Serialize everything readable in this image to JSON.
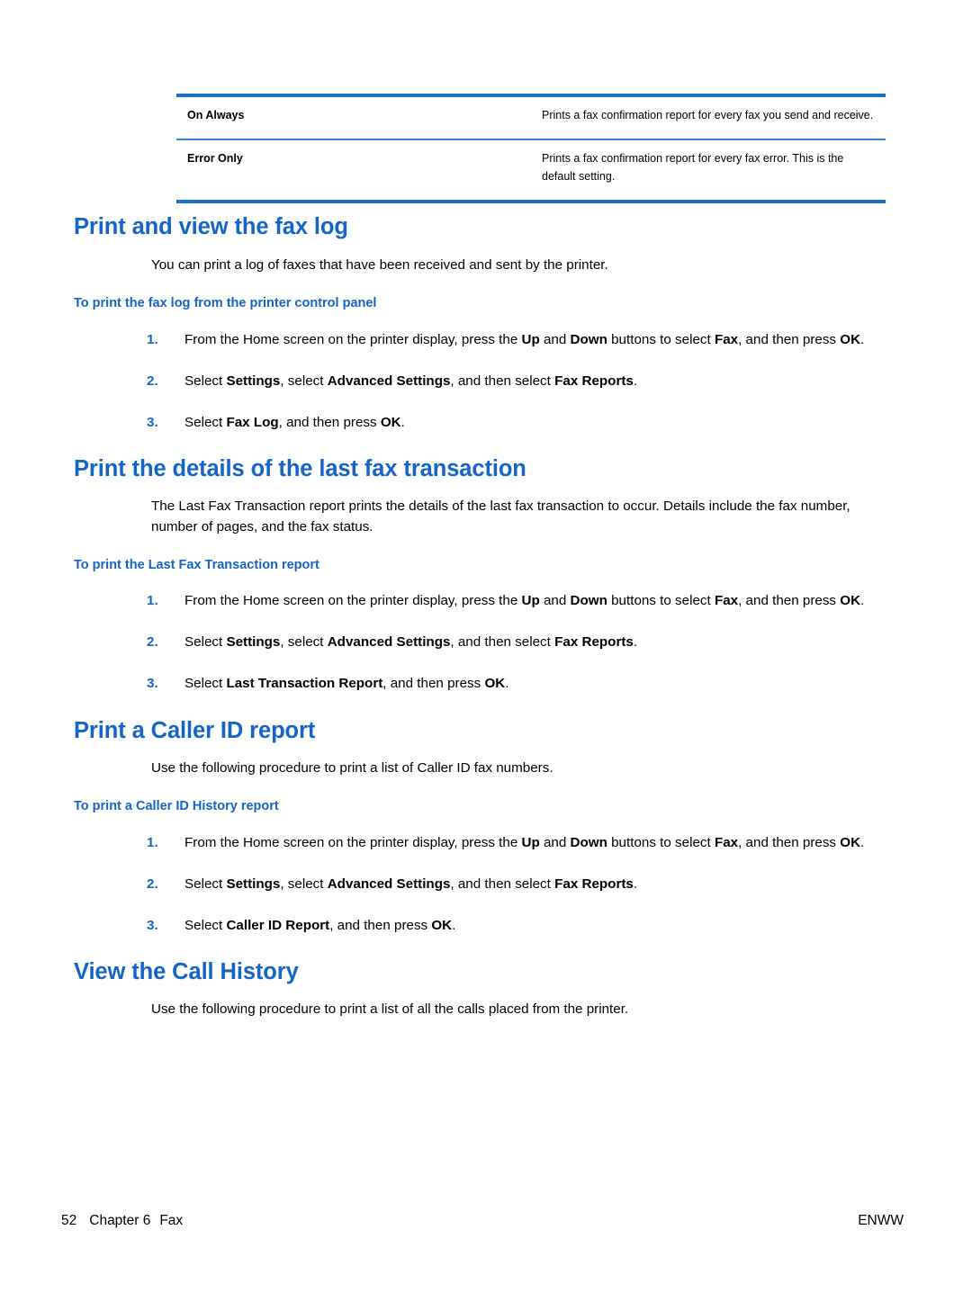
{
  "colors": {
    "heading_blue": "#1565c8",
    "rule_blue": "#1a72c4",
    "divider_blue": "#2f86d4",
    "text_black": "#000000"
  },
  "table": {
    "rows": [
      {
        "name": "On Always",
        "description": "Prints a fax confirmation report for every fax you send and receive."
      },
      {
        "name": "Error Only",
        "description": "Prints a fax confirmation report for every fax error. This is the default setting."
      }
    ]
  },
  "sections": [
    {
      "heading": "Print and view the fax log",
      "intro": "You can print a log of faxes that have been received and sent by the printer.",
      "subheading": "To print the fax log from the printer control panel",
      "steps": [
        {
          "num": "1.",
          "parts": [
            {
              "t": "From the Home screen on the printer display, press the ",
              "b": false
            },
            {
              "t": "Up",
              "b": true
            },
            {
              "t": " and ",
              "b": false
            },
            {
              "t": "Down",
              "b": true
            },
            {
              "t": " buttons to select ",
              "b": false
            },
            {
              "t": "Fax",
              "b": true
            },
            {
              "t": ", and then press ",
              "b": false
            },
            {
              "t": "OK",
              "b": true
            },
            {
              "t": ".",
              "b": false
            }
          ]
        },
        {
          "num": "2.",
          "parts": [
            {
              "t": "Select ",
              "b": false
            },
            {
              "t": "Settings",
              "b": true
            },
            {
              "t": ", select ",
              "b": false
            },
            {
              "t": "Advanced Settings",
              "b": true
            },
            {
              "t": ", and then select ",
              "b": false
            },
            {
              "t": "Fax Reports",
              "b": true
            },
            {
              "t": ".",
              "b": false
            }
          ]
        },
        {
          "num": "3.",
          "parts": [
            {
              "t": "Select ",
              "b": false
            },
            {
              "t": "Fax Log",
              "b": true
            },
            {
              "t": ", and then press ",
              "b": false
            },
            {
              "t": "OK",
              "b": true
            },
            {
              "t": ".",
              "b": false
            }
          ]
        }
      ]
    },
    {
      "heading": "Print the details of the last fax transaction",
      "intro": "The Last Fax Transaction report prints the details of the last fax transaction to occur. Details include the fax number, number of pages, and the fax status.",
      "subheading": "To print the Last Fax Transaction report",
      "steps": [
        {
          "num": "1.",
          "parts": [
            {
              "t": "From the Home screen on the printer display, press the ",
              "b": false
            },
            {
              "t": "Up",
              "b": true
            },
            {
              "t": " and ",
              "b": false
            },
            {
              "t": "Down",
              "b": true
            },
            {
              "t": " buttons to select ",
              "b": false
            },
            {
              "t": "Fax",
              "b": true
            },
            {
              "t": ", and then press ",
              "b": false
            },
            {
              "t": "OK",
              "b": true
            },
            {
              "t": ".",
              "b": false
            }
          ]
        },
        {
          "num": "2.",
          "parts": [
            {
              "t": "Select ",
              "b": false
            },
            {
              "t": "Settings",
              "b": true
            },
            {
              "t": ", select ",
              "b": false
            },
            {
              "t": "Advanced Settings",
              "b": true
            },
            {
              "t": ", and then select ",
              "b": false
            },
            {
              "t": "Fax Reports",
              "b": true
            },
            {
              "t": ".",
              "b": false
            }
          ]
        },
        {
          "num": "3.",
          "parts": [
            {
              "t": "Select ",
              "b": false
            },
            {
              "t": "Last Transaction Report",
              "b": true
            },
            {
              "t": ", and then press ",
              "b": false
            },
            {
              "t": "OK",
              "b": true
            },
            {
              "t": ".",
              "b": false
            }
          ]
        }
      ]
    },
    {
      "heading": "Print a Caller ID report",
      "intro": "Use the following procedure to print a list of Caller ID fax numbers.",
      "subheading": "To print a Caller ID History report",
      "steps": [
        {
          "num": "1.",
          "parts": [
            {
              "t": "From the Home screen on the printer display, press the ",
              "b": false
            },
            {
              "t": "Up",
              "b": true
            },
            {
              "t": " and ",
              "b": false
            },
            {
              "t": "Down",
              "b": true
            },
            {
              "t": " buttons to select ",
              "b": false
            },
            {
              "t": "Fax",
              "b": true
            },
            {
              "t": ", and then press ",
              "b": false
            },
            {
              "t": "OK",
              "b": true
            },
            {
              "t": ".",
              "b": false
            }
          ]
        },
        {
          "num": "2.",
          "parts": [
            {
              "t": "Select ",
              "b": false
            },
            {
              "t": "Settings",
              "b": true
            },
            {
              "t": ", select ",
              "b": false
            },
            {
              "t": "Advanced Settings",
              "b": true
            },
            {
              "t": ", and then select ",
              "b": false
            },
            {
              "t": "Fax Reports",
              "b": true
            },
            {
              "t": ".",
              "b": false
            }
          ]
        },
        {
          "num": "3.",
          "parts": [
            {
              "t": "Select ",
              "b": false
            },
            {
              "t": "Caller ID Report",
              "b": true
            },
            {
              "t": ", and then press ",
              "b": false
            },
            {
              "t": "OK",
              "b": true
            },
            {
              "t": ".",
              "b": false
            }
          ]
        }
      ]
    },
    {
      "heading": "View the Call History",
      "intro": "Use the following procedure to print a list of all the calls placed from the printer.",
      "subheading": null,
      "steps": []
    }
  ],
  "footer": {
    "page_number": "52",
    "chapter": "Chapter 6",
    "chapter_title": "Fax",
    "locale": "ENWW"
  }
}
